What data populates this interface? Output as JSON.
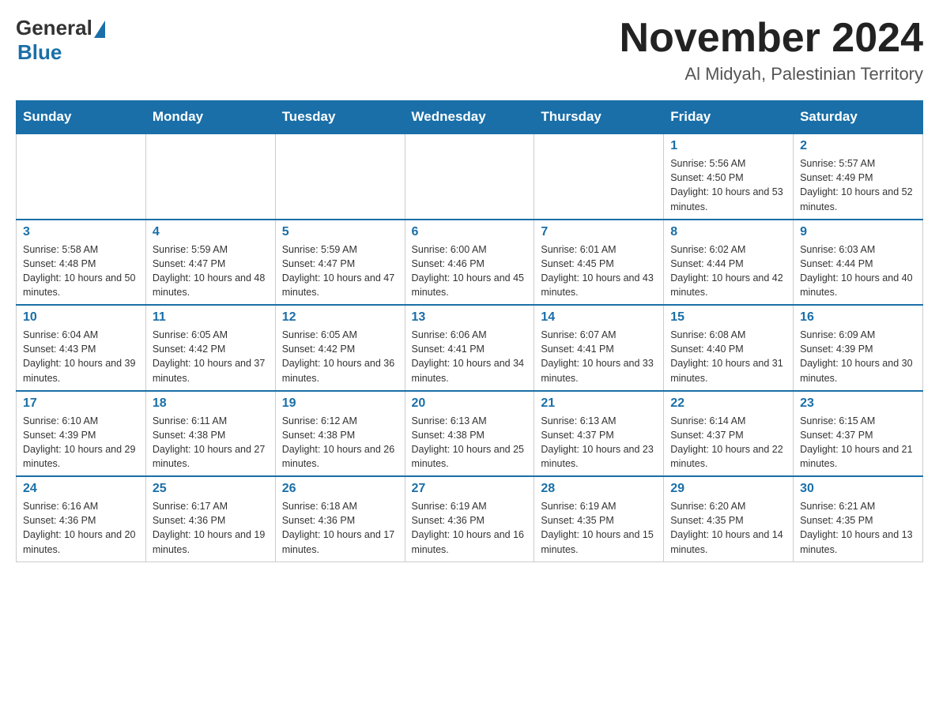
{
  "header": {
    "logo_general": "General",
    "logo_blue": "Blue",
    "month_title": "November 2024",
    "location": "Al Midyah, Palestinian Territory"
  },
  "days_of_week": [
    "Sunday",
    "Monday",
    "Tuesday",
    "Wednesday",
    "Thursday",
    "Friday",
    "Saturday"
  ],
  "weeks": [
    [
      {
        "day": "",
        "info": ""
      },
      {
        "day": "",
        "info": ""
      },
      {
        "day": "",
        "info": ""
      },
      {
        "day": "",
        "info": ""
      },
      {
        "day": "",
        "info": ""
      },
      {
        "day": "1",
        "info": "Sunrise: 5:56 AM\nSunset: 4:50 PM\nDaylight: 10 hours and 53 minutes."
      },
      {
        "day": "2",
        "info": "Sunrise: 5:57 AM\nSunset: 4:49 PM\nDaylight: 10 hours and 52 minutes."
      }
    ],
    [
      {
        "day": "3",
        "info": "Sunrise: 5:58 AM\nSunset: 4:48 PM\nDaylight: 10 hours and 50 minutes."
      },
      {
        "day": "4",
        "info": "Sunrise: 5:59 AM\nSunset: 4:47 PM\nDaylight: 10 hours and 48 minutes."
      },
      {
        "day": "5",
        "info": "Sunrise: 5:59 AM\nSunset: 4:47 PM\nDaylight: 10 hours and 47 minutes."
      },
      {
        "day": "6",
        "info": "Sunrise: 6:00 AM\nSunset: 4:46 PM\nDaylight: 10 hours and 45 minutes."
      },
      {
        "day": "7",
        "info": "Sunrise: 6:01 AM\nSunset: 4:45 PM\nDaylight: 10 hours and 43 minutes."
      },
      {
        "day": "8",
        "info": "Sunrise: 6:02 AM\nSunset: 4:44 PM\nDaylight: 10 hours and 42 minutes."
      },
      {
        "day": "9",
        "info": "Sunrise: 6:03 AM\nSunset: 4:44 PM\nDaylight: 10 hours and 40 minutes."
      }
    ],
    [
      {
        "day": "10",
        "info": "Sunrise: 6:04 AM\nSunset: 4:43 PM\nDaylight: 10 hours and 39 minutes."
      },
      {
        "day": "11",
        "info": "Sunrise: 6:05 AM\nSunset: 4:42 PM\nDaylight: 10 hours and 37 minutes."
      },
      {
        "day": "12",
        "info": "Sunrise: 6:05 AM\nSunset: 4:42 PM\nDaylight: 10 hours and 36 minutes."
      },
      {
        "day": "13",
        "info": "Sunrise: 6:06 AM\nSunset: 4:41 PM\nDaylight: 10 hours and 34 minutes."
      },
      {
        "day": "14",
        "info": "Sunrise: 6:07 AM\nSunset: 4:41 PM\nDaylight: 10 hours and 33 minutes."
      },
      {
        "day": "15",
        "info": "Sunrise: 6:08 AM\nSunset: 4:40 PM\nDaylight: 10 hours and 31 minutes."
      },
      {
        "day": "16",
        "info": "Sunrise: 6:09 AM\nSunset: 4:39 PM\nDaylight: 10 hours and 30 minutes."
      }
    ],
    [
      {
        "day": "17",
        "info": "Sunrise: 6:10 AM\nSunset: 4:39 PM\nDaylight: 10 hours and 29 minutes."
      },
      {
        "day": "18",
        "info": "Sunrise: 6:11 AM\nSunset: 4:38 PM\nDaylight: 10 hours and 27 minutes."
      },
      {
        "day": "19",
        "info": "Sunrise: 6:12 AM\nSunset: 4:38 PM\nDaylight: 10 hours and 26 minutes."
      },
      {
        "day": "20",
        "info": "Sunrise: 6:13 AM\nSunset: 4:38 PM\nDaylight: 10 hours and 25 minutes."
      },
      {
        "day": "21",
        "info": "Sunrise: 6:13 AM\nSunset: 4:37 PM\nDaylight: 10 hours and 23 minutes."
      },
      {
        "day": "22",
        "info": "Sunrise: 6:14 AM\nSunset: 4:37 PM\nDaylight: 10 hours and 22 minutes."
      },
      {
        "day": "23",
        "info": "Sunrise: 6:15 AM\nSunset: 4:37 PM\nDaylight: 10 hours and 21 minutes."
      }
    ],
    [
      {
        "day": "24",
        "info": "Sunrise: 6:16 AM\nSunset: 4:36 PM\nDaylight: 10 hours and 20 minutes."
      },
      {
        "day": "25",
        "info": "Sunrise: 6:17 AM\nSunset: 4:36 PM\nDaylight: 10 hours and 19 minutes."
      },
      {
        "day": "26",
        "info": "Sunrise: 6:18 AM\nSunset: 4:36 PM\nDaylight: 10 hours and 17 minutes."
      },
      {
        "day": "27",
        "info": "Sunrise: 6:19 AM\nSunset: 4:36 PM\nDaylight: 10 hours and 16 minutes."
      },
      {
        "day": "28",
        "info": "Sunrise: 6:19 AM\nSunset: 4:35 PM\nDaylight: 10 hours and 15 minutes."
      },
      {
        "day": "29",
        "info": "Sunrise: 6:20 AM\nSunset: 4:35 PM\nDaylight: 10 hours and 14 minutes."
      },
      {
        "day": "30",
        "info": "Sunrise: 6:21 AM\nSunset: 4:35 PM\nDaylight: 10 hours and 13 minutes."
      }
    ]
  ]
}
